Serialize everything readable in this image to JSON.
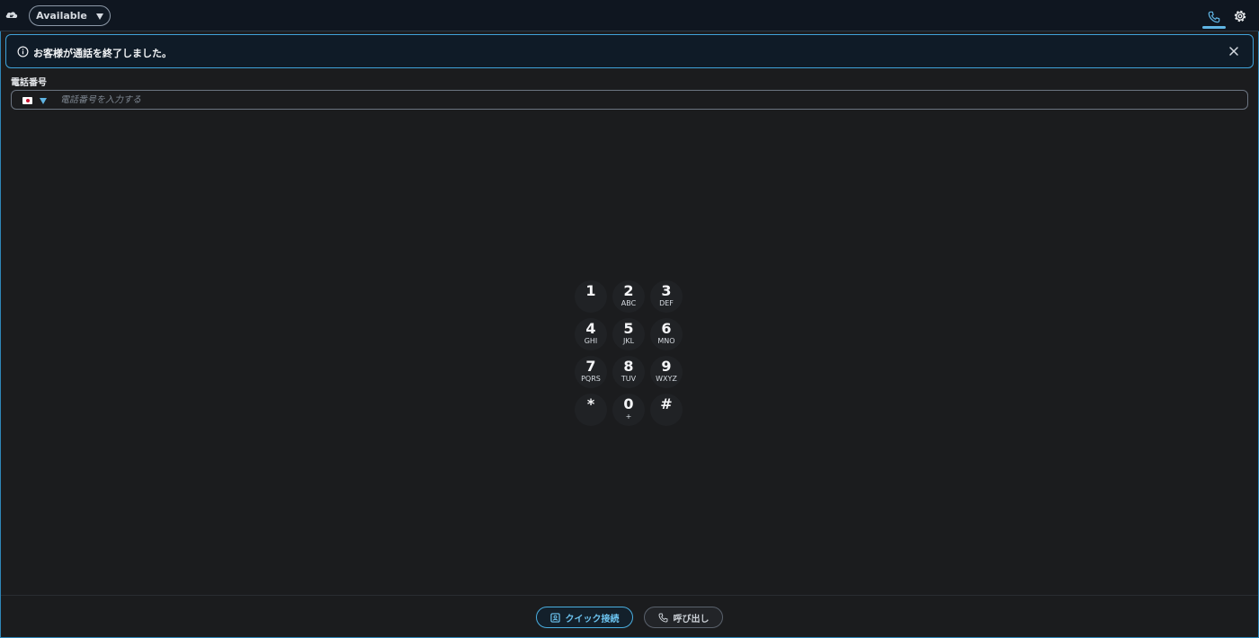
{
  "topbar": {
    "logo_icon": "cloud-chat-icon",
    "status_label": "Available",
    "phone_tab_icon": "phone-icon",
    "settings_icon": "gear-icon"
  },
  "alert": {
    "icon": "info-icon",
    "message": "お客様が通話を終了しました。",
    "close_icon": "close-icon"
  },
  "phone": {
    "label": "電話番号",
    "country_flag": "japan-flag",
    "placeholder": "電話番号を入力する",
    "value": ""
  },
  "keypad": {
    "keys": [
      {
        "digit": "1",
        "letters": ""
      },
      {
        "digit": "2",
        "letters": "ABC"
      },
      {
        "digit": "3",
        "letters": "DEF"
      },
      {
        "digit": "4",
        "letters": "GHI"
      },
      {
        "digit": "5",
        "letters": "JKL"
      },
      {
        "digit": "6",
        "letters": "MNO"
      },
      {
        "digit": "7",
        "letters": "PQRS"
      },
      {
        "digit": "8",
        "letters": "TUV"
      },
      {
        "digit": "9",
        "letters": "WXYZ"
      },
      {
        "digit": "*",
        "letters": ""
      },
      {
        "digit": "0",
        "letters": "+"
      },
      {
        "digit": "#",
        "letters": ""
      }
    ]
  },
  "footer": {
    "quick_connect_label": "クイック接続",
    "quick_connect_icon": "contact-card-icon",
    "call_label": "呼び出し",
    "call_icon": "phone-icon"
  },
  "colors": {
    "accent": "#5fb4e3",
    "background": "#1b1c1e",
    "topbar": "#0f1620"
  }
}
